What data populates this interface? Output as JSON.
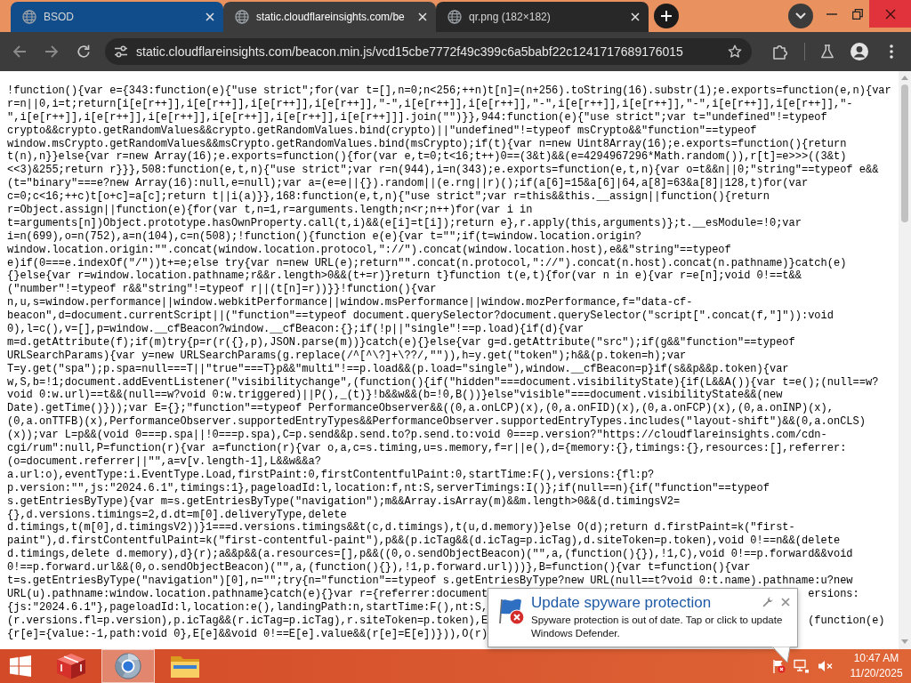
{
  "browser": {
    "tabs": [
      {
        "title": "BSOD",
        "selected": false,
        "color": "#114d8a"
      },
      {
        "title": "static.cloudflareinsights.com/be",
        "selected": true,
        "color": "#3c3c3c"
      },
      {
        "title": "qr.png (182×182)",
        "selected": false,
        "color": "#282828"
      }
    ],
    "address_bar": {
      "url": "static.cloudflareinsights.com/beacon.min.js/vcd15cbe7772f49c399c6a5babf22c1241717689176015"
    }
  },
  "page": {
    "code_lines": [
      "!function(){var e={343:function(e){\"use strict\";for(var t=[],n=0;n<256;++n)t[n]=(n+256).toString(16).substr(1);e.exports=function(e,n){var",
      "r=n||0,i=t;return[i[e[r++]],i[e[r++]],i[e[r++]],i[e[r++]],\"-\",i[e[r++]],i[e[r++]],\"-\",i[e[r++]],i[e[r++]],\"-\",i[e[r++]],i[e[r++]],\"-",
      "\",i[e[r++]],i[e[r++]],i[e[r++]],i[e[r++]],i[e[r++]],i[e[r++]]].join(\"\")}},944:function(e){\"use strict\";var t=\"undefined\"!=typeof",
      "crypto&&crypto.getRandomValues&&crypto.getRandomValues.bind(crypto)||\"undefined\"!=typeof msCrypto&&\"function\"==typeof",
      "window.msCrypto.getRandomValues&&msCrypto.getRandomValues.bind(msCrypto);if(t){var n=new Uint8Array(16);e.exports=function(){return",
      "t(n),n}}else{var r=new Array(16);e.exports=function(){for(var e,t=0;t<16;t++)0==(3&t)&&(e=4294967296*Math.random()),r[t]=e>>>((3&t)",
      "<<3)&255;return r}}},508:function(e,t,n){\"use strict\";var r=n(944),i=n(343);e.exports=function(e,t,n){var o=t&&n||0;\"string\"==typeof e&&",
      "(t=\"binary\"===e?new Array(16):null,e=null);var a=(e=e||{}).random||(e.rng||r)();if(a[6]=15&a[6]|64,a[8]=63&a[8]|128,t)for(var",
      "c=0;c<16;++c)t[o+c]=a[c];return t||i(a)}},168:function(e,t,n){\"use strict\";var r=this&&this.__assign||function(){return",
      "r=Object.assign||function(e){for(var t,n=1,r=arguments.length;n<r;n++)for(var i in",
      "t=arguments[n])Object.prototype.hasOwnProperty.call(t,i)&&(e[i]=t[i]);return e},r.apply(this,arguments)};t.__esModule=!0;var",
      "i=n(699),o=n(752),a=n(104),c=n(508);!function(){function e(e){var t=\"\";if(t=window.location.origin?",
      "window.location.origin:\"\".concat(window.location.protocol,\"://\").concat(window.location.host),e&&\"string\"==typeof",
      "e)if(0===e.indexOf(\"/\"))t+=e;else try{var n=new URL(e);return\"\".concat(n.protocol,\"://\").concat(n.host).concat(n.pathname)}catch(e)",
      "{}else{var r=window.location.pathname;r&&r.length>0&&(t+=r)}return t}function t(e,t){for(var n in e){var r=e[n];void 0!==t&&",
      "(\"number\"!=typeof r&&\"string\"!=typeof r||(t[n]=r))}}!function(){var",
      "n,u,s=window.performance||window.webkitPerformance||window.msPerformance||window.mozPerformance,f=\"data-cf-",
      "beacon\",d=document.currentScript||(\"function\"==typeof document.querySelector?document.querySelector(\"script[\".concat(f,\"]\")):void",
      "0),l=c(),v=[],p=window.__cfBeacon?window.__cfBeacon:{};if(!p||\"single\"!==p.load){if(d){var",
      "m=d.getAttribute(f);if(m)try{p=r(r({},p),JSON.parse(m))}catch(e){}else{var g=d.getAttribute(\"src\");if(g&&\"function\"==typeof",
      "URLSearchParams){var y=new URLSearchParams(g.replace(/^[^\\?]+\\??/,\"\")),h=y.get(\"token\");h&&(p.token=h);var",
      "T=y.get(\"spa\");p.spa=null===T||\"true\"===T}p&&\"multi\"!==p.load&&(p.load=\"single\"),window.__cfBeacon=p}if(s&&p&&p.token){var",
      "w,S,b=!1;document.addEventListener(\"visibilitychange\",(function(){if(\"hidden\"===document.visibilityState){if(L&&A()){var t=e();(null==w?",
      "void 0:w.url)==t&&(null==w?void 0:w.triggered)||P(),_(t)}!b&&w&&(b=!0,B())}else\"visible\"===document.visibilityState&&(new",
      "Date).getTime()}));var E={};\"function\"==typeof PerformanceObserver&&((0,a.onLCP)(x),(0,a.onFID)(x),(0,a.onFCP)(x),(0,a.onINP)(x),",
      "(0,a.onTTFB)(x),PerformanceObserver.supportedEntryTypes&&PerformanceObserver.supportedEntryTypes.includes(\"layout-shift\")&&(0,a.onCLS)",
      "(x));var L=p&&(void 0===p.spa||!0===p.spa),C=p.send&&p.send.to?p.send.to:void 0===p.version?\"https://cloudflareinsights.com/cdn-",
      "cgi/rum\":null,P=function(r){var a=function(r){var o,a,c=s.timing,u=s.memory,f=r||e(),d={memory:{},timings:{},resources:[],referrer:",
      "(o=document.referrer||\"\",a=v[v.length-1],L&&w&&a?",
      "a.url:o),eventType:i.EventType.Load,firstPaint:0,firstContentfulPaint:0,startTime:F(),versions:{fl:p?",
      "p.version:\"\",js:\"2024.6.1\",timings:1},pageloadId:l,location:f,nt:S,serverTimings:I()};if(null==n){if(\"function\"==typeof",
      "s.getEntriesByType){var m=s.getEntriesByType(\"navigation\");m&&Array.isArray(m)&&m.length>0&&(d.timingsV2=",
      "{},d.versions.timings=2,d.dt=m[0].deliveryType,delete",
      "d.timings,t(m[0],d.timingsV2))}1===d.versions.timings&&t(c,d.timings),t(u,d.memory)}else O(d);return d.firstPaint=k(\"first-",
      "paint\"),d.firstContentfulPaint=k(\"first-contentful-paint\"),p&&(p.icTag&&(d.icTag=p.icTag),d.siteToken=p.token),void 0!==n&&(delete",
      "d.timings,delete d.memory),d}(r);a&&p&&(a.resources=[],p&&((0,o.sendObjectBeacon)(\"\",a,(function(){}),!1,C),void 0!==p.forward&&void",
      "0!==p.forward.url&&(0,o.sendObjectBeacon)(\"\",a,(function(){}),!1,p.forward.url)))},B=function(){var t=function(){var",
      "t=s.getEntriesByType(\"navigation\")[0],n=\"\";try{n=\"function\"==typeof s.getEntriesByType?new URL(null==t?void 0:t.name).pathname:u?new"
    ],
    "covered_lines": [
      {
        "left": "URL(u).pathname:window.location.pathname}catch(e){}var r={referrer:document",
        "right": "ersions:"
      },
      {
        "left": "{js:\"2024.6.1\"},pageloadId:l,location:e(),landingPath:n,startTime:F(),nt:S,"
      },
      {
        "left": "(r.versions.fl=p.version),p.icTag&&(r.icTag=p.icTag),r.siteToken=p.token),E",
        "right": "(function(e)"
      },
      {
        "left": "{r[e]={value:-1,path:void 0},E[e]&&void 0!==E[e].value&&(r[e]=E[e])})),O(r)"
      }
    ]
  },
  "notification": {
    "title": "Update spyware protection",
    "message": "Spyware protection is out of date. Tap or click to update Windows Defender."
  },
  "taskbar": {
    "apps": [
      {
        "kind": "cube",
        "selected": false
      },
      {
        "kind": "orb",
        "selected": true
      },
      {
        "kind": "folder",
        "selected": false
      }
    ],
    "time": "10:47 AM",
    "date": "11/20/2025"
  }
}
